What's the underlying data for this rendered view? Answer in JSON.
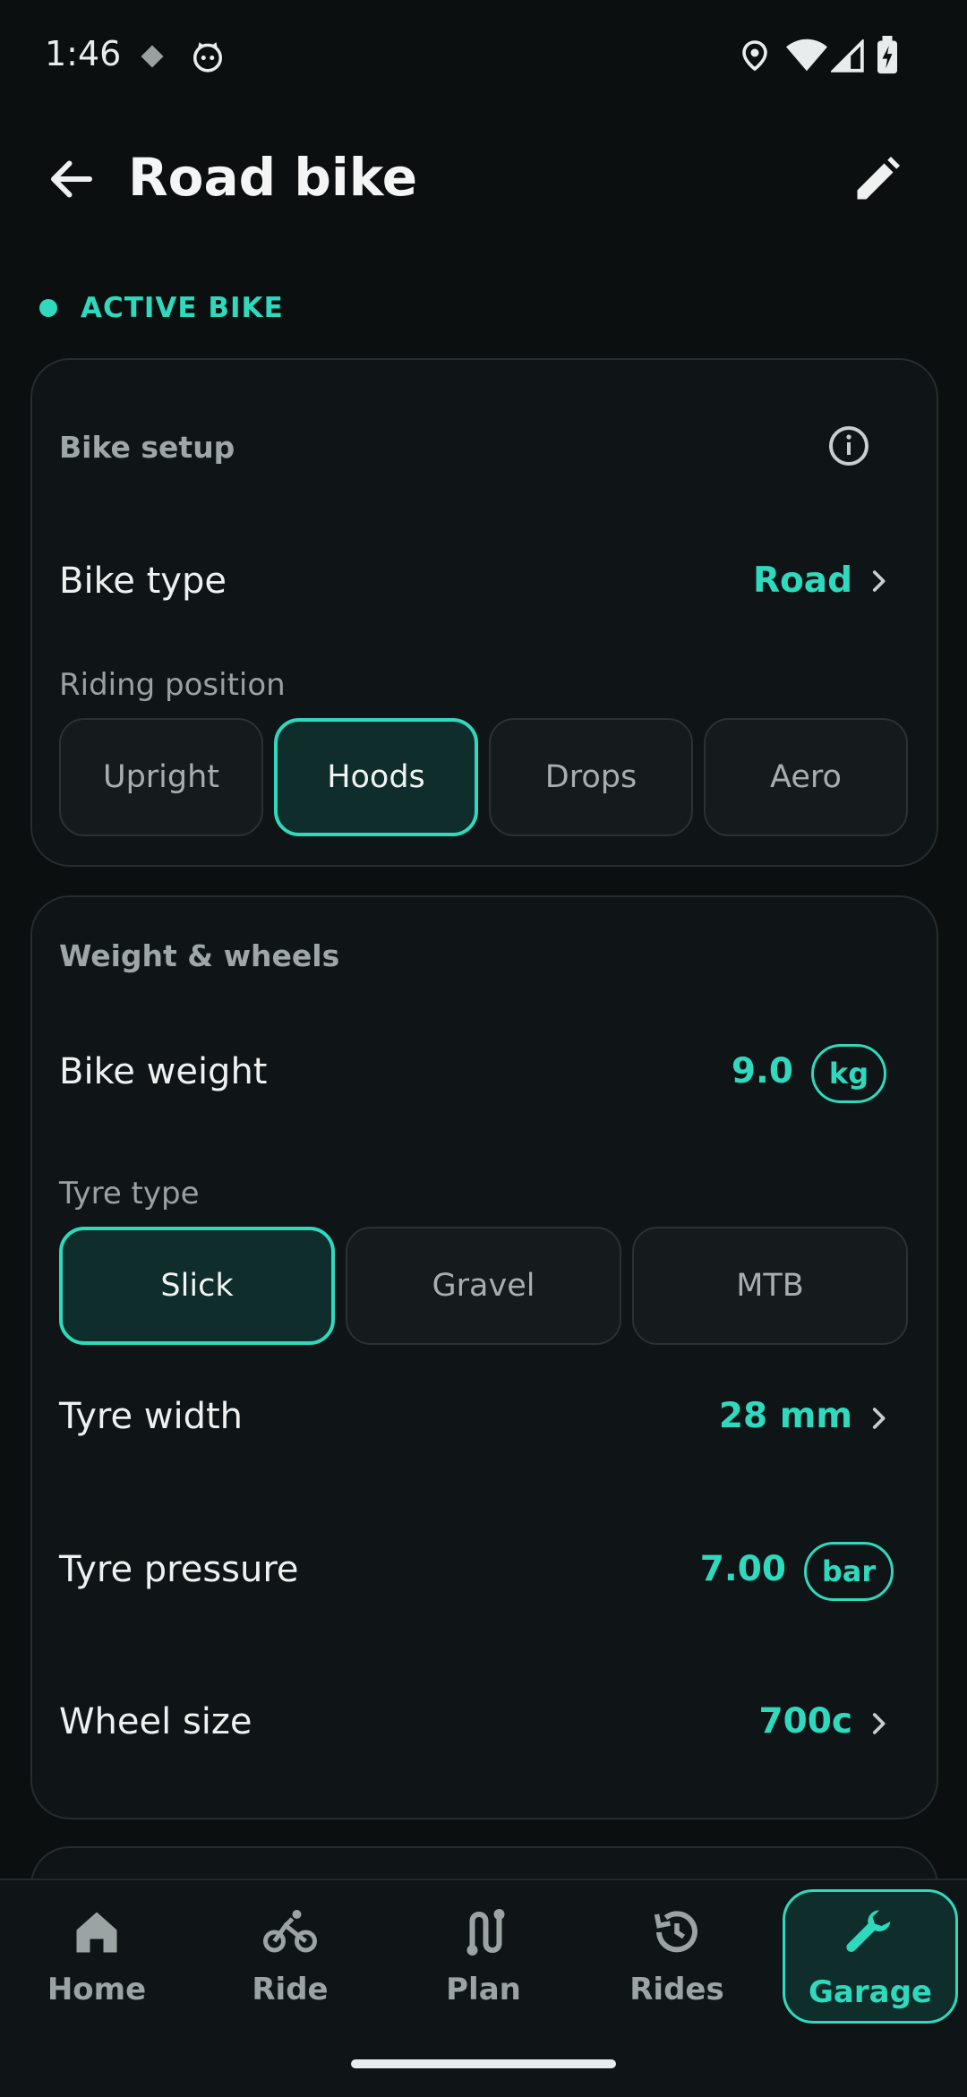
{
  "status": {
    "time": "1:46"
  },
  "header": {
    "title": "Road bike"
  },
  "active_label": "ACTIVE BIKE",
  "setup": {
    "title": "Bike setup",
    "bike_type_label": "Bike type",
    "bike_type_value": "Road",
    "riding_position_label": "Riding position",
    "positions": [
      "Upright",
      "Hoods",
      "Drops",
      "Aero"
    ],
    "selected_position": "Hoods"
  },
  "weight": {
    "title": "Weight & wheels",
    "bike_weight_label": "Bike weight",
    "bike_weight_value": "9.0",
    "bike_weight_unit": "kg",
    "tyre_type_label": "Tyre type",
    "tyre_types": [
      "Slick",
      "Gravel",
      "MTB"
    ],
    "selected_tyre": "Slick",
    "tyre_width_label": "Tyre width",
    "tyre_width_value": "28 mm",
    "tyre_pressure_label": "Tyre pressure",
    "tyre_pressure_value": "7.00",
    "tyre_pressure_unit": "bar",
    "wheel_size_label": "Wheel size",
    "wheel_size_value": "700c"
  },
  "nav": {
    "items": [
      {
        "label": "Home",
        "icon": "home-icon"
      },
      {
        "label": "Ride",
        "icon": "bike-icon"
      },
      {
        "label": "Plan",
        "icon": "route-icon"
      },
      {
        "label": "Rides",
        "icon": "history-icon"
      },
      {
        "label": "Garage",
        "icon": "wrench-icon"
      }
    ],
    "selected": "Garage"
  },
  "colors": {
    "accent": "#2fd9be",
    "background": "#0b0f10",
    "card": "#0f1416"
  }
}
